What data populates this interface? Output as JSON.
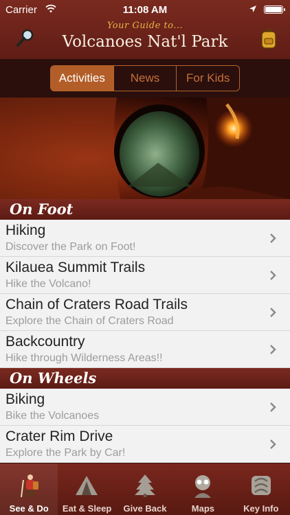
{
  "status": {
    "carrier": "Carrier",
    "time": "11:08 AM"
  },
  "header": {
    "tagline": "Your Guide to...",
    "title": "Volcanoes Nat'l Park"
  },
  "segments": [
    "Activities",
    "News",
    "For Kids"
  ],
  "sections": [
    {
      "title": "On Foot",
      "rows": [
        {
          "title": "Hiking",
          "subtitle": "Discover the Park on Foot!"
        },
        {
          "title": "Kilauea Summit Trails",
          "subtitle": "Hike the Volcano!"
        },
        {
          "title": "Chain of Craters Road Trails",
          "subtitle": "Explore the Chain of Craters Road"
        },
        {
          "title": "Backcountry",
          "subtitle": "Hike through Wilderness Areas!!"
        }
      ]
    },
    {
      "title": "On Wheels",
      "rows": [
        {
          "title": "Biking",
          "subtitle": "Bike the Volcanoes"
        },
        {
          "title": "Crater Rim Drive",
          "subtitle": "Explore the Park by Car!"
        }
      ]
    }
  ],
  "tabs": [
    {
      "label": "See & Do",
      "icon": "hiker-icon"
    },
    {
      "label": "Eat & Sleep",
      "icon": "tent-icon"
    },
    {
      "label": "Give Back",
      "icon": "tree-icon"
    },
    {
      "label": "Maps",
      "icon": "map-guide-icon"
    },
    {
      "label": "Key Info",
      "icon": "info-icon"
    }
  ],
  "colors": {
    "header": "#6b231a",
    "accent": "#b35e29",
    "segbar": "#2a0f0c",
    "title_tag": "#e6b548"
  }
}
